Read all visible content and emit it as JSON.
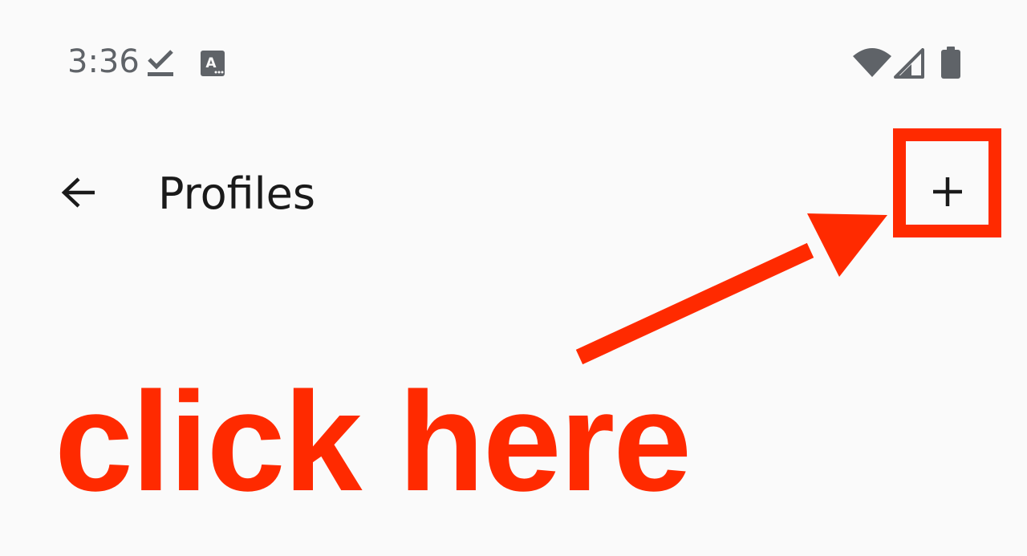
{
  "status_bar": {
    "time": "3:36",
    "icons": [
      "download-done-icon",
      "accessibility-text-icon",
      "wifi-icon",
      "signal-icon",
      "battery-icon"
    ]
  },
  "app_bar": {
    "title": "Profiles",
    "back_icon": "arrow-back-icon",
    "add_icon": "plus-icon"
  },
  "annotation": {
    "text": "click here",
    "color": "#ff2a00"
  }
}
